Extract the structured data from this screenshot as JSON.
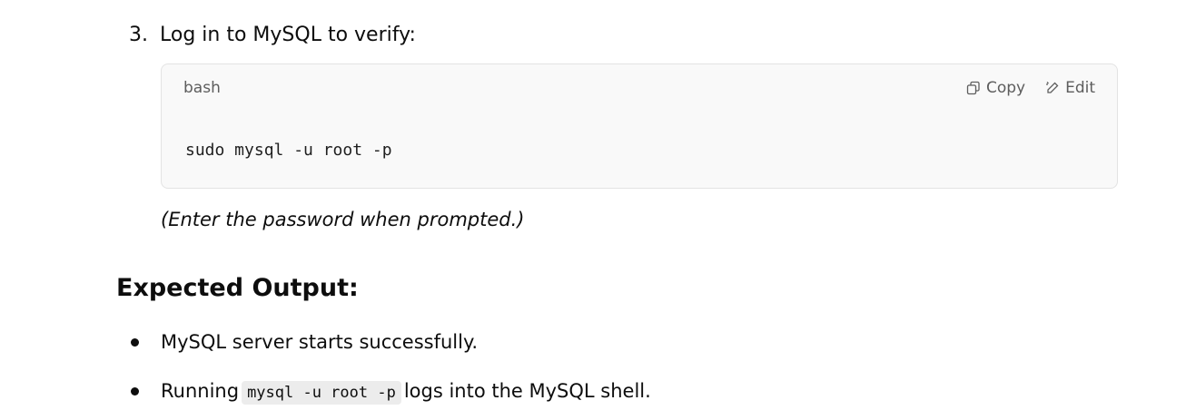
{
  "step": {
    "number": "3.",
    "text": "Log in to MySQL to verify:"
  },
  "code_block": {
    "language": "bash",
    "copy_label": "Copy",
    "edit_label": "Edit",
    "code": "sudo mysql -u root -p",
    "copy_icon": "copy-icon",
    "edit_icon": "edit-icon"
  },
  "note": "(Enter the password when prompted.)",
  "heading": "Expected Output:",
  "bullets": {
    "first": "MySQL server starts successfully.",
    "second_prefix": "Running",
    "second_code": "mysql -u root -p",
    "second_suffix": "logs into the MySQL shell."
  }
}
